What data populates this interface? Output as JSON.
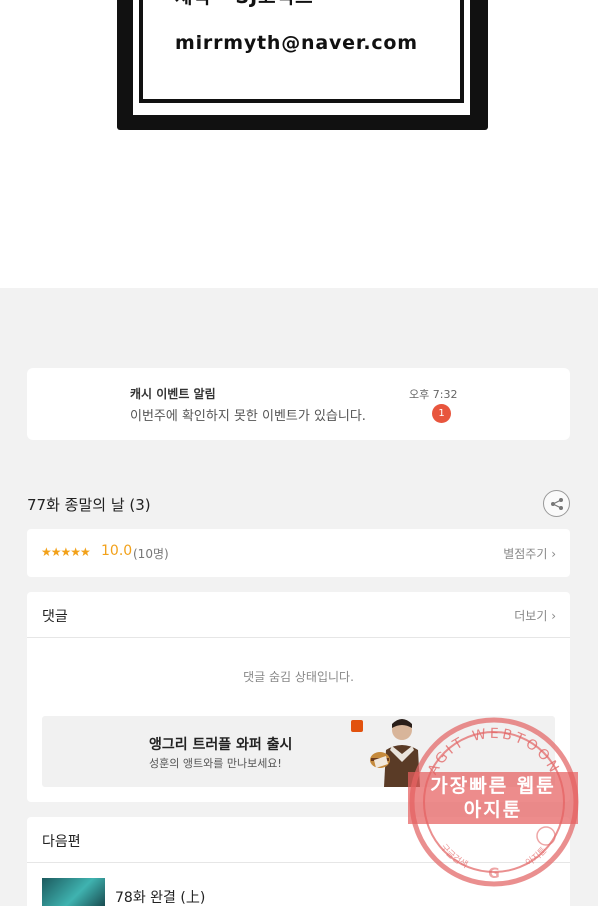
{
  "comic": {
    "credit_partial": "제작 · SJ코믹스",
    "email": "mirrmyth@naver.com"
  },
  "notification": {
    "title": "캐시 이벤트 알림",
    "body": "이번주에 확인하지 못한 이벤트가 있습니다.",
    "time": "오후 7:32",
    "badge_count": "1"
  },
  "episode": {
    "title": "77화 종말의 날 (3)",
    "share_icon": "share-icon"
  },
  "rating": {
    "stars": "★★★★★",
    "score": "10.0",
    "votes": "(10명)",
    "rate_button": "별점주기 ›"
  },
  "comments": {
    "label": "댓글",
    "more": "더보기 ›",
    "hidden_message": "댓글 숨김 상태입니다."
  },
  "ad": {
    "title": "앵그리 트러플 와퍼 출시",
    "subtitle": "성훈의 앵트와를 만나보세요!"
  },
  "next": {
    "label": "다음편",
    "episode_title": "78화 완결 (上)"
  },
  "watermark": {
    "arc_text": "AGIT WEBTOON",
    "line1": "가장빠른 웹툰",
    "line2": "아지툰",
    "bottom_left": "구글검색",
    "bottom_right": "아지툰",
    "color": "#e36a6a"
  }
}
